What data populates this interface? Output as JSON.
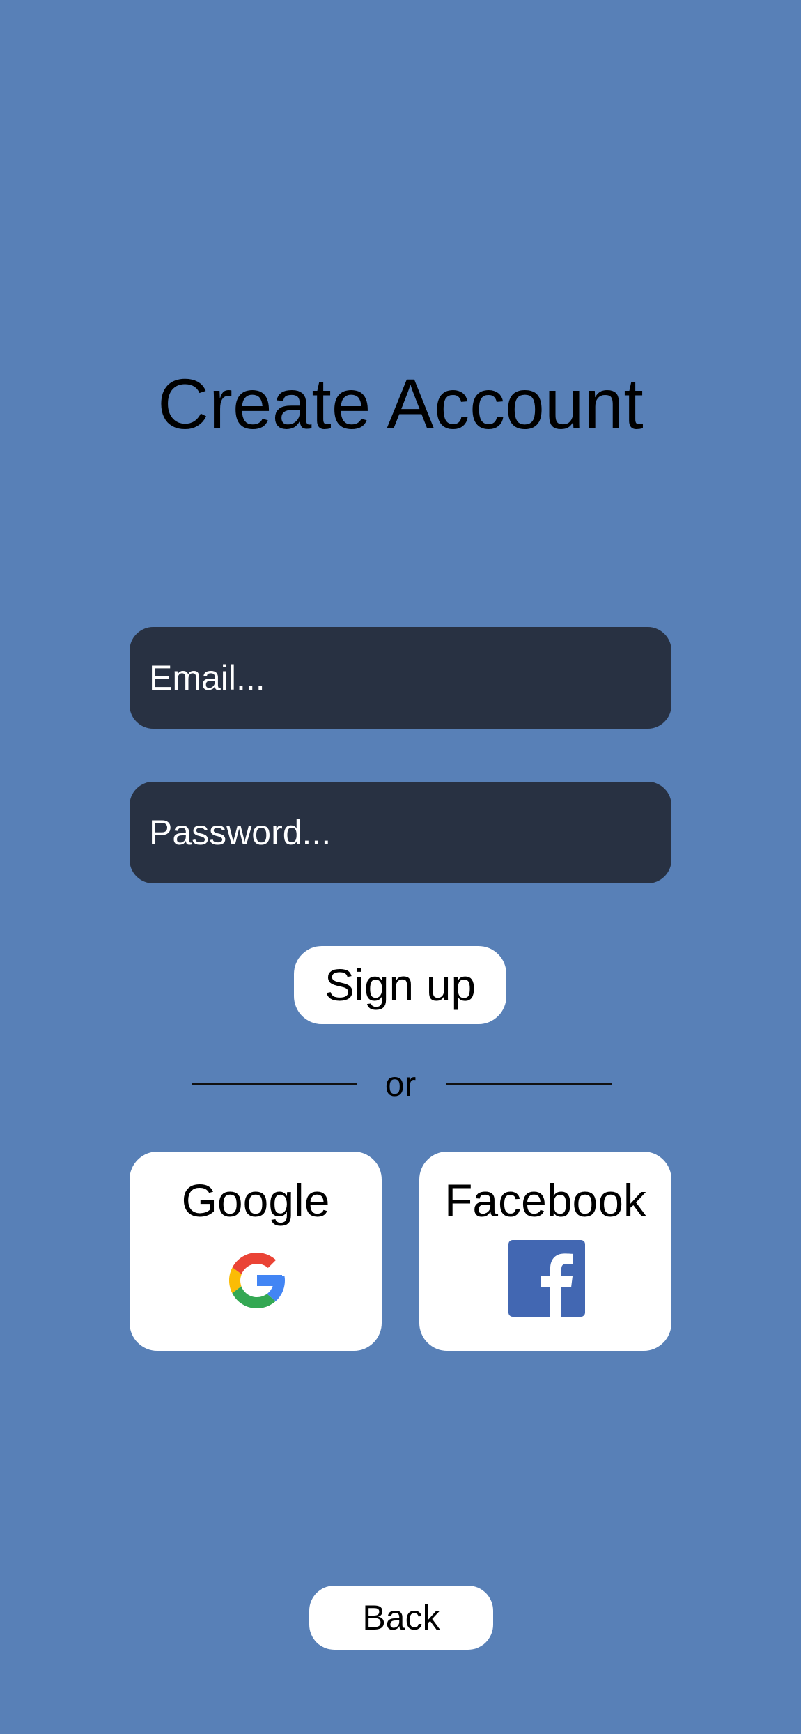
{
  "screen": {
    "title": "Create Account",
    "background_color": "#5880b7"
  },
  "form": {
    "email": {
      "value": "",
      "placeholder": "Email..."
    },
    "password": {
      "value": "",
      "placeholder": "Password..."
    },
    "field_color": "#283142"
  },
  "actions": {
    "signup_label": "Sign up",
    "divider_text": "or",
    "back_label": "Back"
  },
  "social": {
    "google": {
      "label": "Google",
      "icon": "google-g-icon"
    },
    "facebook": {
      "label": "Facebook",
      "icon": "facebook-f-icon",
      "color": "#4267b2"
    }
  }
}
